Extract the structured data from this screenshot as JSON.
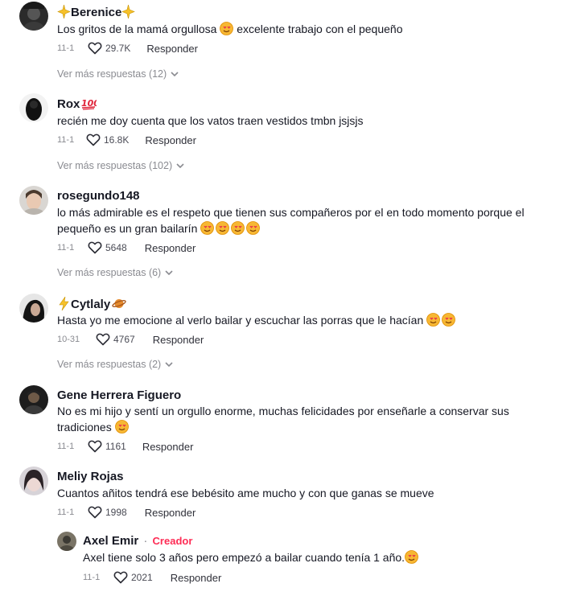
{
  "comments": [
    {
      "name": "Berenice",
      "text": "Los gritos de la mamá orgullosa",
      "text2": " excelente trabajo con el pequeño",
      "date": "11-1",
      "likes": "29.7K",
      "reply_label": "Responder",
      "more_replies": "Ver más respuestas (12)"
    },
    {
      "name": "Rox",
      "text": "recién me doy cuenta que los vatos traen vestidos tmbn jsjsjs",
      "date": "11-1",
      "likes": "16.8K",
      "reply_label": "Responder",
      "more_replies": "Ver más respuestas (102)"
    },
    {
      "name": "rosegundo148",
      "text_line1": "lo más admirable es el respeto que tienen sus compañeros por el en todo momento porque el",
      "text_line2": "pequeño es un gran bailarín",
      "date": "11-1",
      "likes": "5648",
      "reply_label": "Responder",
      "more_replies": "Ver más respuestas (6)"
    },
    {
      "name": "Cytlaly",
      "text": "Hasta yo me emocione al verlo bailar y escuchar las porras que le hacían",
      "date": "10-31",
      "likes": "4767",
      "reply_label": "Responder",
      "more_replies": "Ver más respuestas (2)"
    },
    {
      "name": "Gene Herrera Figuero",
      "text_line1": "No es mi hijo y sentí un orgullo enorme, muchas felicidades por enseñarle a conservar sus",
      "text_line2": "tradiciones",
      "date": "11-1",
      "likes": "1161",
      "reply_label": "Responder"
    },
    {
      "name": "Meliy Rojas",
      "text": "Cuantos añitos tendrá ese bebésito ame mucho y con que ganas se mueve",
      "date": "11-1",
      "likes": "1998",
      "reply_label": "Responder"
    }
  ],
  "reply": {
    "name": "Axel Emir",
    "separator": "·",
    "badge": "Creador",
    "text": "Axel tiene solo 3 años pero empezó a bailar cuando tenía 1 año.",
    "date": "11-1",
    "likes": "2021",
    "reply_label": "Responder"
  },
  "colors": {
    "creator_badge": "#fe2c55",
    "text": "#161823",
    "muted": "#8a8b91"
  },
  "icons": [
    "heart-outline-icon",
    "chevron-down-icon",
    "smiling-hearts-emoji",
    "sparkle-emoji",
    "hundred-points-emoji",
    "lightning-emoji",
    "ringed-planet-emoji"
  ]
}
